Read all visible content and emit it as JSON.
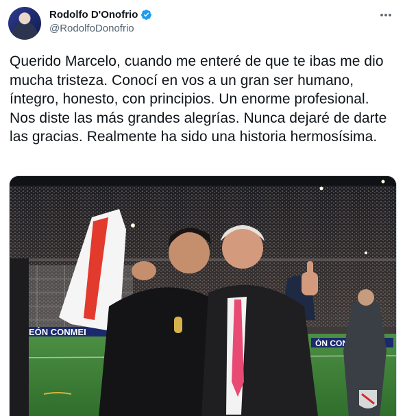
{
  "author": {
    "display_name": "Rodolfo D'Onofrio",
    "handle": "@RodolfoDonofrio",
    "verified": true,
    "avatar_icon": "profile-photo"
  },
  "tweet": {
    "text": "Querido Marcelo, cuando me enteré de que te ibas me dio mucha tristeza. Conocí en vos a un gran ser humano, íntegro, honesto, con principios. Un enorme profesional. Nos diste las más grandes alegrías. Nunca dejaré de darte las gracias. Realmente ha sido una historia hermosísima."
  },
  "media": {
    "banner_text_left": "EÓN CONMEI",
    "banner_text_right": "ÓN CONME"
  },
  "colors": {
    "accent_verified": "#1d9bf0",
    "text_primary": "#0f1419",
    "text_secondary": "#536471",
    "pitch_green": "#3d8a3a"
  },
  "icons": {
    "more": "more-dots-icon",
    "verified": "verified-badge-icon"
  }
}
